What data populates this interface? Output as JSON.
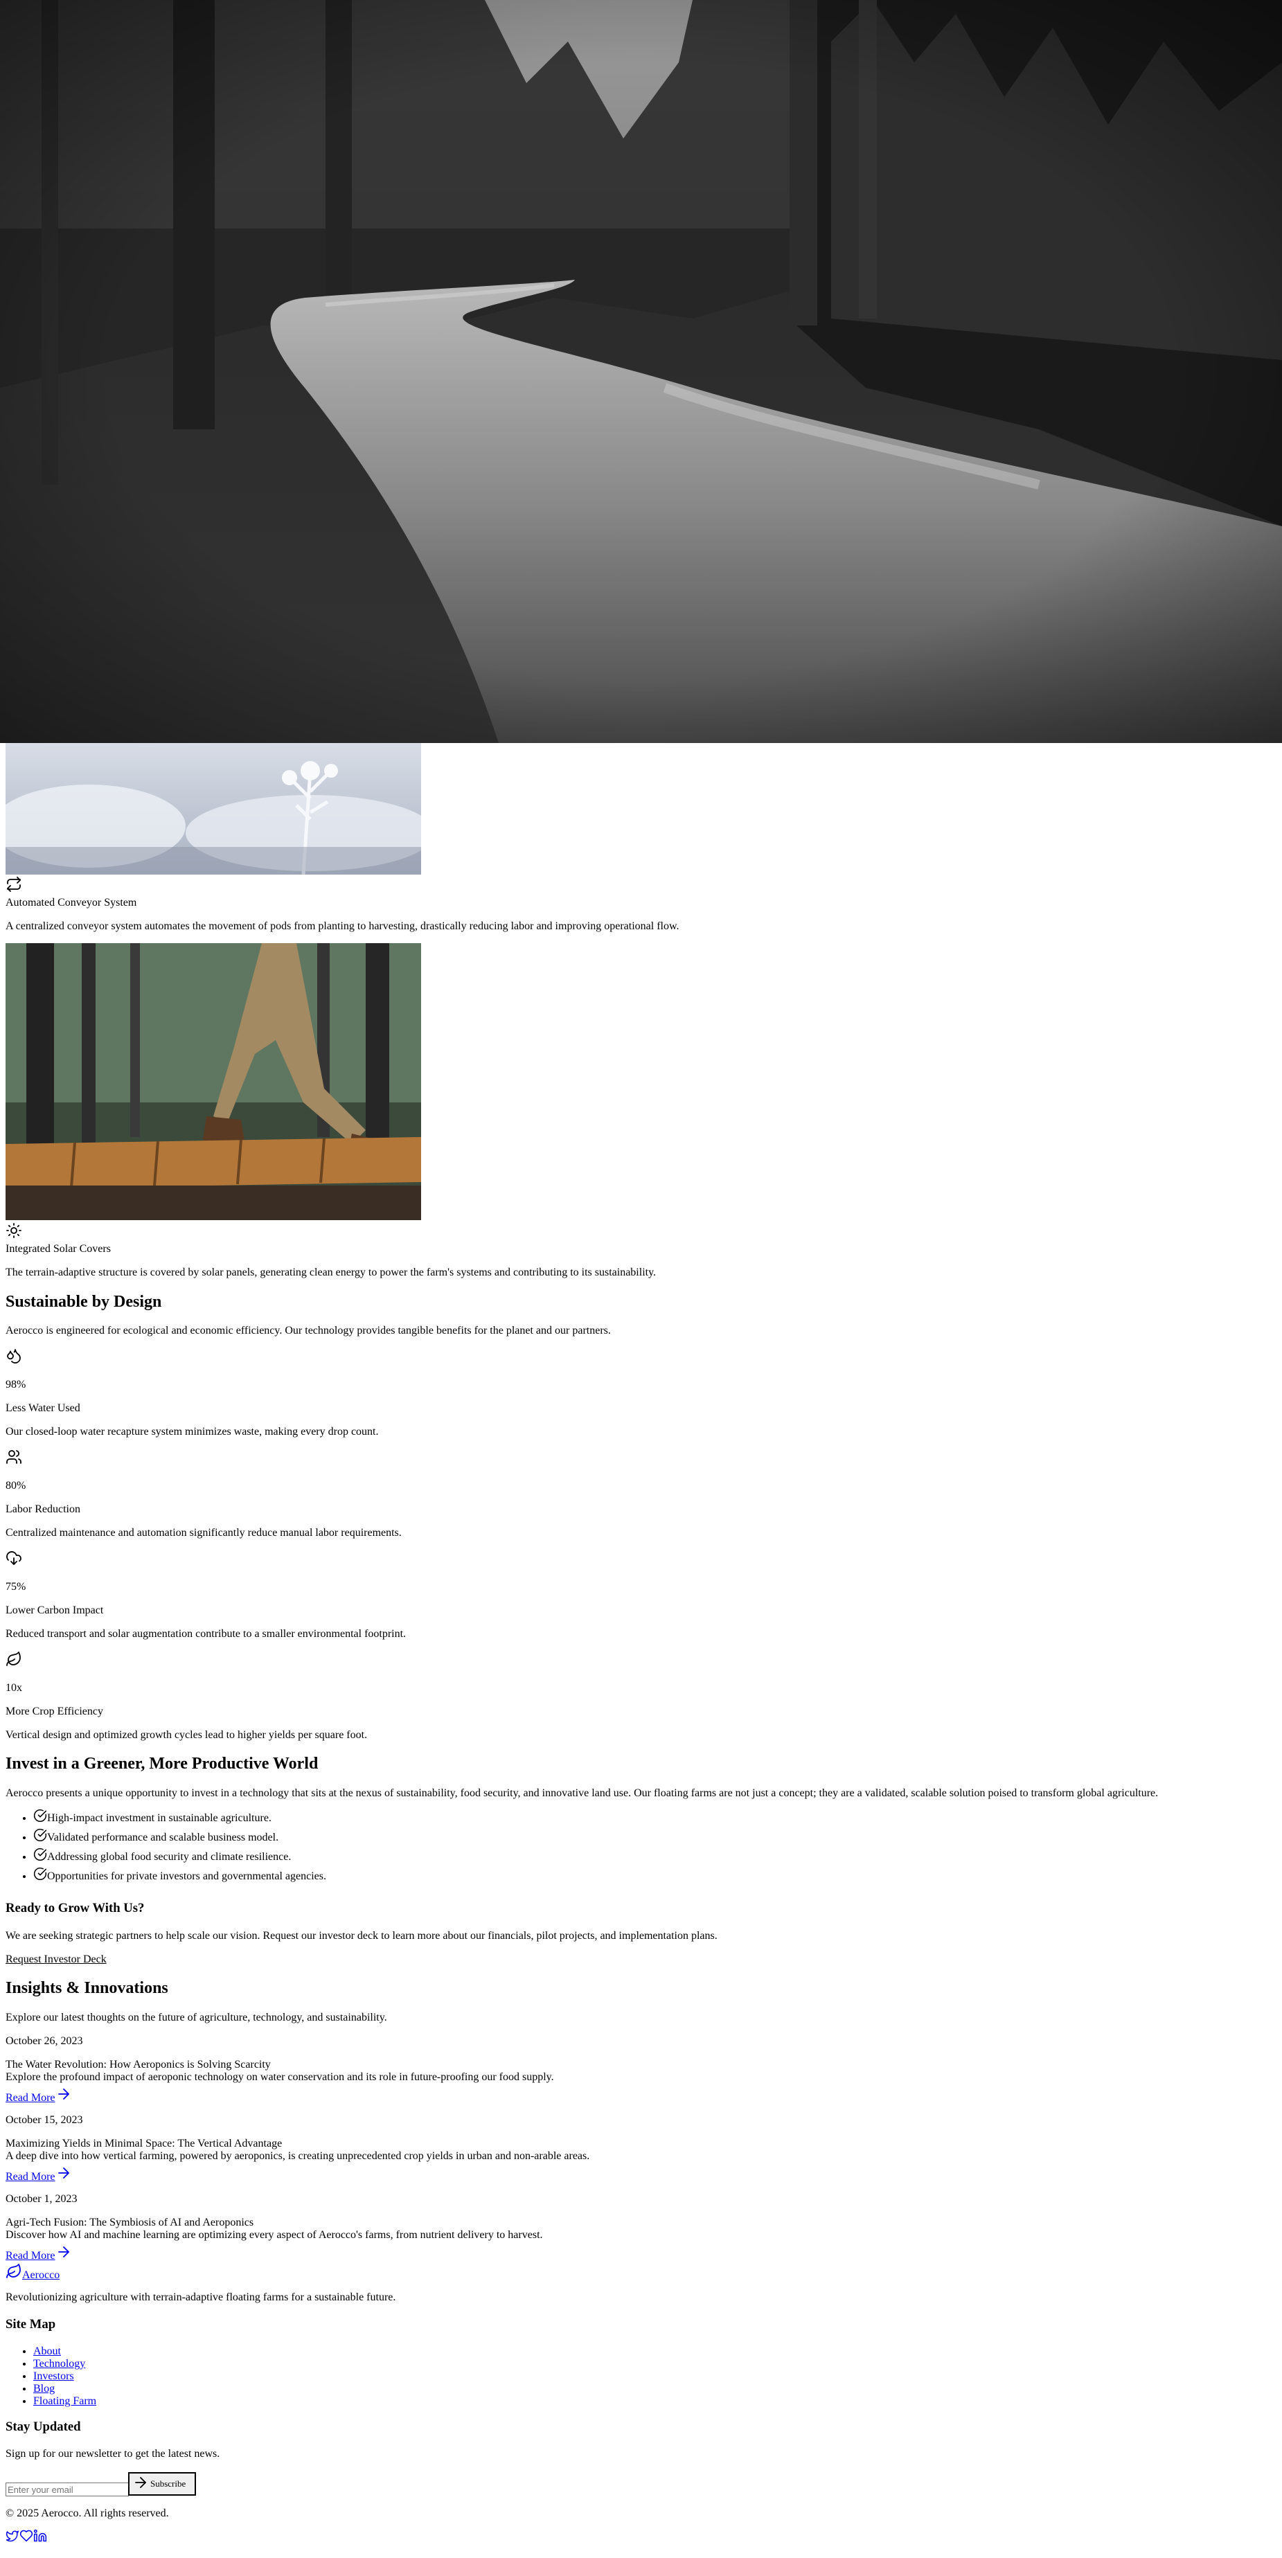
{
  "features": [
    {
      "icon": "repeat-icon",
      "title": "Automated Conveyor System",
      "description": "A centralized conveyor system automates the movement of pods from planting to harvesting, drastically reducing labor and improving operational flow."
    },
    {
      "icon": "sun-icon",
      "title": "Integrated Solar Covers",
      "description": "The terrain-adaptive structure is covered by solar panels, generating clean energy to power the farm's systems and contributing to its sustainability."
    }
  ],
  "sustainable": {
    "heading": "Sustainable by Design",
    "intro": "Aerocco is engineered for ecological and economic efficiency. Our technology provides tangible benefits for the planet and our partners.",
    "stats": [
      {
        "icon": "droplets-icon",
        "value": "98%",
        "label": "Less Water Used",
        "description": "Our closed-loop water recapture system minimizes waste, making every drop count."
      },
      {
        "icon": "users-icon",
        "value": "80%",
        "label": "Labor Reduction",
        "description": "Centralized maintenance and automation significantly reduce manual labor requirements."
      },
      {
        "icon": "cloud-download-icon",
        "value": "75%",
        "label": "Lower Carbon Impact",
        "description": "Reduced transport and solar augmentation contribute to a smaller environmental footprint."
      },
      {
        "icon": "leaf-icon",
        "value": "10x",
        "label": "More Crop Efficiency",
        "description": "Vertical design and optimized growth cycles lead to higher yields per square foot."
      }
    ]
  },
  "invest": {
    "heading": "Invest in a Greener, More Productive World",
    "intro": "Aerocco presents a unique opportunity to invest in a technology that sits at the nexus of sustainability, food security, and innovative land use. Our floating farms are not just a concept; they are a validated, scalable solution poised to transform global agriculture.",
    "points": [
      "High-impact investment in sustainable agriculture.",
      "Validated performance and scalable business model.",
      "Addressing global food security and climate resilience.",
      "Opportunities for private investors and governmental agencies."
    ],
    "cta_heading": "Ready to Grow With Us?",
    "cta_text": "We are seeking strategic partners to help scale our vision. Request our investor deck to learn more about our financials, pilot projects, and implementation plans.",
    "cta_link": "Request Investor Deck"
  },
  "insights": {
    "heading": "Insights & Innovations",
    "intro": "Explore our latest thoughts on the future of agriculture, technology, and sustainability.",
    "read_more": "Read More",
    "posts": [
      {
        "date": "October 26, 2023",
        "title": "The Water Revolution: How Aeroponics is Solving Scarcity",
        "excerpt": "Explore the profound impact of aeroponic technology on water conservation and its role in future-proofing our food supply."
      },
      {
        "date": "October 15, 2023",
        "title": "Maximizing Yields in Minimal Space: The Vertical Advantage",
        "excerpt": "A deep dive into how vertical farming, powered by aeroponics, is creating unprecedented crop yields in urban and non-arable areas."
      },
      {
        "date": "October 1, 2023",
        "title": "Agri-Tech Fusion: The Symbiosis of AI and Aeroponics",
        "excerpt": "Discover how AI and machine learning are optimizing every aspect of Aerocco's farms, from nutrient delivery to harvest."
      }
    ]
  },
  "footer": {
    "brand": "Aerocco",
    "tagline": "Revolutionizing agriculture with terrain-adaptive floating farms for a sustainable future.",
    "sitemap_heading": "Site Map",
    "sitemap": [
      "About",
      "Technology",
      "Investors",
      "Blog",
      "Floating Farm"
    ],
    "newsletter_heading": "Stay Updated",
    "newsletter_text": "Sign up for our newsletter to get the latest news.",
    "email_placeholder": "Enter your email",
    "subscribe_label": "Subscribe",
    "copyright": "© 2025 Aerocco. All rights reserved.",
    "social_icons": [
      "twitter-icon",
      "facebook-icon",
      "linkedin-icon"
    ]
  },
  "colors": {
    "link": "#0000ee",
    "text": "#000000",
    "background": "#ffffff"
  }
}
